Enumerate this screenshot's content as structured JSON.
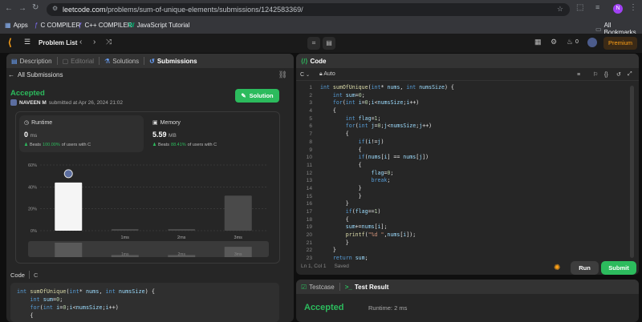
{
  "browser": {
    "url_host": "leetcode.com",
    "url_path": "/problems/sum-of-unique-elements/submissions/1242583369/",
    "bookmarks": [
      "Apps",
      "C COMPILER",
      "C++ COMPILER",
      "JavaScript Tutorial"
    ],
    "all_bookmarks": "All Bookmarks",
    "avatar_letter": "N"
  },
  "header": {
    "problem_list": "Problem List",
    "streak": "0",
    "premium": "Premium"
  },
  "left": {
    "tabs": [
      "Description",
      "Editorial",
      "Solutions",
      "Submissions"
    ],
    "back_label": "All Submissions",
    "status": "Accepted",
    "author": "NAVEEN M",
    "submitted": "submitted at Apr 26, 2024 21:02",
    "solution_btn": "Solution",
    "runtime": {
      "label": "Runtime",
      "value": "0",
      "unit": "ms",
      "beats_word": "Beats",
      "beats_pct": "100.00%",
      "beats_suffix": "of users with C"
    },
    "memory": {
      "label": "Memory",
      "value": "5.59",
      "unit": "MB",
      "beats_word": "Beats",
      "beats_pct": "88.41%",
      "beats_suffix": "of users with C"
    },
    "code_header": {
      "title": "Code",
      "lang": "C"
    }
  },
  "chart_data": {
    "type": "bar",
    "categories": [
      "0ms",
      "1ms",
      "2ms",
      "3ms"
    ],
    "tick_labels": [
      "",
      "1ms",
      "2ms",
      "3ms"
    ],
    "values": [
      44,
      1.5,
      1.5,
      32
    ],
    "highlight_index": 0,
    "yticks": [
      "60%",
      "40%",
      "20%",
      "0%"
    ],
    "ylim": [
      0,
      60
    ],
    "mini_values": [
      14,
      2,
      2,
      10
    ]
  },
  "editor": {
    "title": "Code",
    "lang": "C",
    "mode": "Auto",
    "status_pos": "Ln 1, Col 1",
    "status_saved": "Saved",
    "run": "Run",
    "submit": "Submit"
  },
  "code_lines": [
    "int sumOfUnique(int* nums, int numsSize) {",
    "    int sum=0;",
    "    for(int i=0;i<numsSize;i++)",
    "    {",
    "        int flag=1;",
    "        for(int j=0;j<numsSize;j++)",
    "        {",
    "            if(i!=j)",
    "            {",
    "            if(nums[i] == nums[j])",
    "            {",
    "                flag=0;",
    "                break;",
    "            }",
    "            }",
    "        }",
    "        if(flag==1)",
    "        {",
    "        sum+=nums[i];",
    "        printf(\"%d \",nums[i]);",
    "        }",
    "    }",
    "    return sum;"
  ],
  "left_code_lines": [
    "int sumOfUnique(int* nums, int numsSize) {",
    "    int sum=0;",
    "    for(int i=0;i<numsSize;i++)",
    "    {"
  ],
  "result": {
    "testcase": "Testcase",
    "test_result": "Test Result",
    "status": "Accepted",
    "runtime": "Runtime: 2 ms"
  }
}
